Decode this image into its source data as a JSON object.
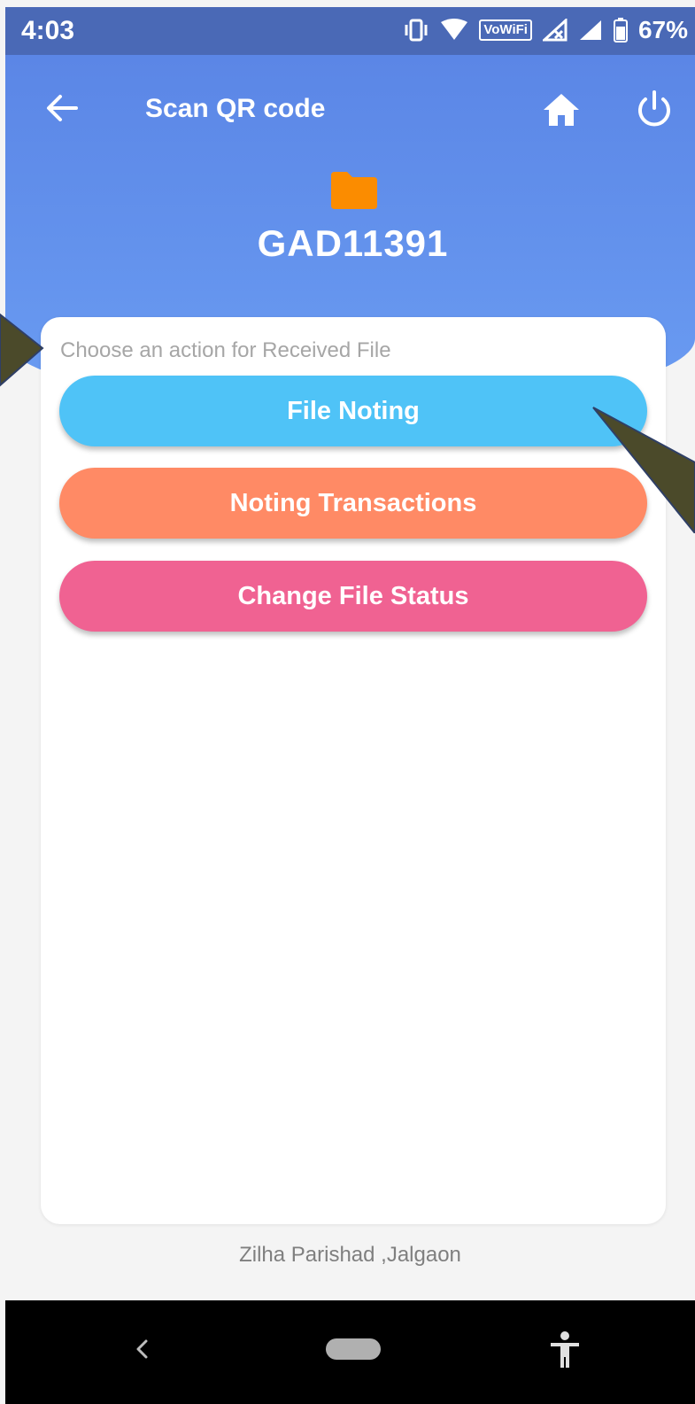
{
  "status_bar": {
    "time": "4:03",
    "vowifi": "VoWiFi",
    "battery": "67%",
    "icons": [
      "vibrate-icon",
      "wifi-icon",
      "vowifi-icon",
      "signal-x-icon",
      "signal-icon",
      "battery-icon"
    ]
  },
  "toolbar": {
    "title": "Scan QR code",
    "back_icon": "arrow-left-icon",
    "home_icon": "home-icon",
    "power_icon": "power-icon"
  },
  "file": {
    "icon": "folder-icon",
    "id": "GAD11391",
    "icon_color": "#fb8c00"
  },
  "actions": {
    "hint": "Choose an action for Received File",
    "buttons": [
      {
        "label": "File Noting",
        "color": "#4fc3f7"
      },
      {
        "label": "Noting Transactions",
        "color": "#ff8a65"
      },
      {
        "label": "Change File Status",
        "color": "#f06292"
      }
    ]
  },
  "footer": {
    "text": "Zilha Parishad ,Jalgaon"
  },
  "nav_bar": {
    "icons": [
      "nav-back-icon",
      "nav-home-icon",
      "accessibility-icon"
    ]
  },
  "colors": {
    "header": "#5b86e6",
    "status_bar": "#4a69b6",
    "callout": "#4b4a2a"
  }
}
